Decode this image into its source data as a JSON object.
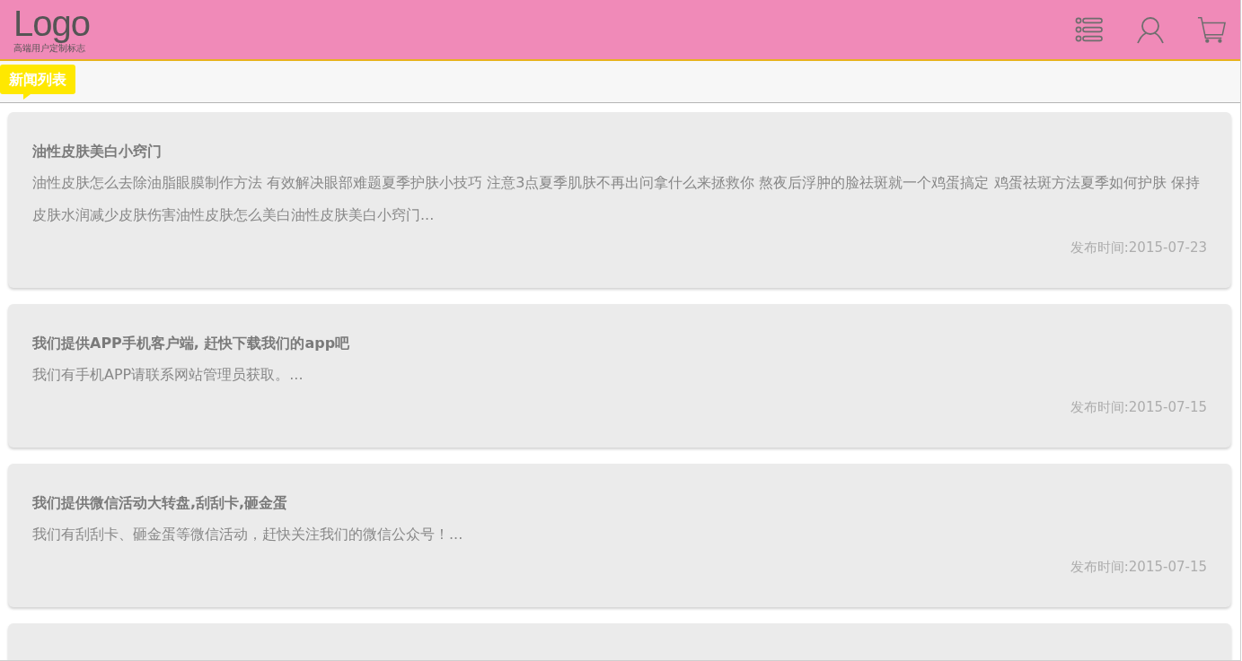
{
  "header": {
    "logo": "Logo",
    "logo_tagline": "高端用户定制标志"
  },
  "section_tag": "新闻列表",
  "news": [
    {
      "kind": "article",
      "title": "油性皮肤美白小窍门",
      "summary": "油性皮肤怎么去除油脂眼膜制作方法 有效解决眼部难题夏季护肤小技巧 注意3点夏季肌肤不再出问拿什么来拯救你 熬夜后浮肿的脸祛斑就一个鸡蛋搞定 鸡蛋祛斑方法夏季如何护肤 保持皮肤水润减少皮肤伤害油性皮肤怎么美白油性皮肤美白小窍门...",
      "date": "发布时间:2015-07-23"
    },
    {
      "kind": "article",
      "title": "我们提供APP手机客户端, 赶快下载我们的app吧",
      "summary": "我们有手机APP请联系网站管理员获取。...",
      "date": "发布时间:2015-07-15"
    },
    {
      "kind": "article",
      "title": "我们提供微信活动大转盘,刮刮卡,砸金蛋",
      "summary": "我们有刮刮卡、砸金蛋等微信活动，赶快关注我们的微信公众号！...",
      "date": "发布时间:2015-07-15"
    },
    {
      "kind": "cut_off"
    }
  ]
}
